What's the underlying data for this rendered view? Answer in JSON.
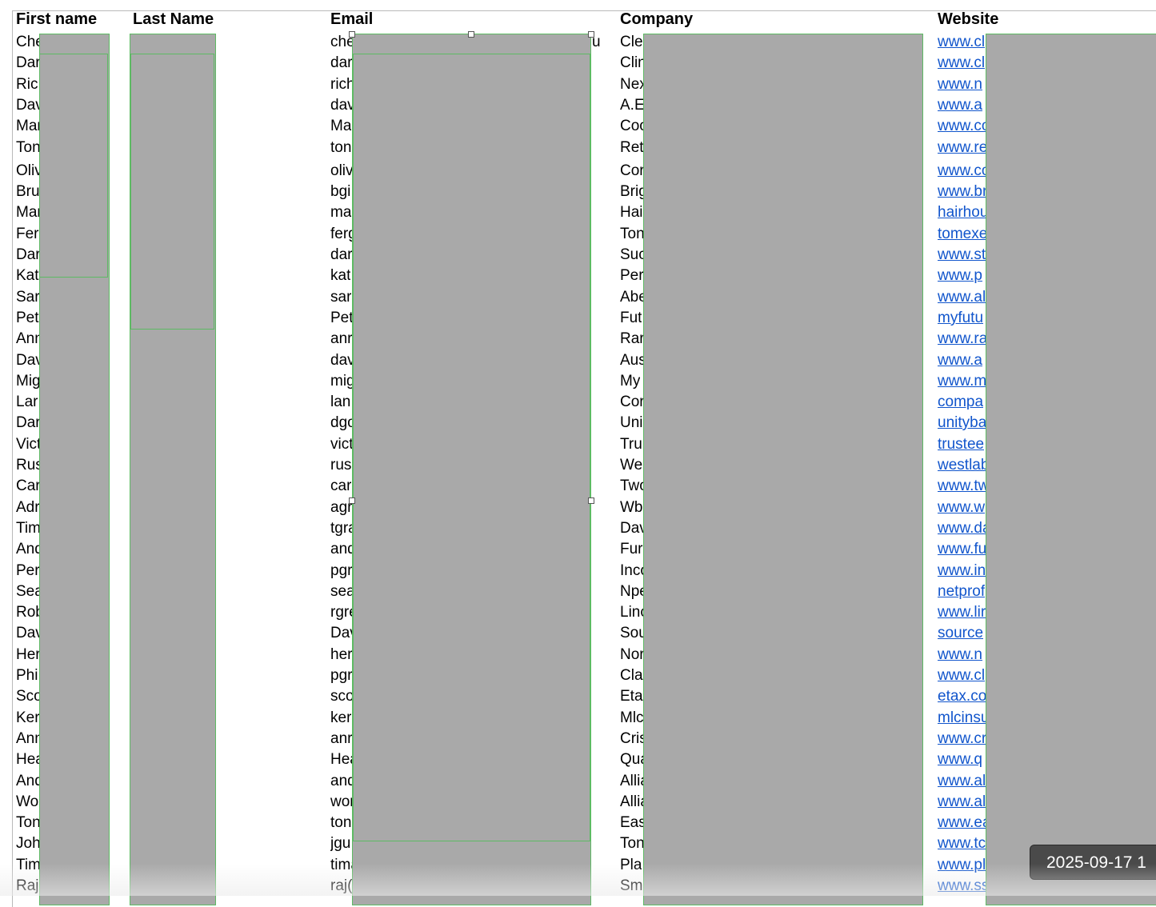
{
  "headers": {
    "first_name": "First name",
    "last_name": "Last Name",
    "email": "Email",
    "company": "Company",
    "website": "Website"
  },
  "rows": [
    {
      "first": "Che",
      "email": "che",
      "company": "Cle",
      "website": "www.cl"
    },
    {
      "first": "Dar",
      "email": "dar",
      "company": "Clin",
      "website": "www.cl"
    },
    {
      "first": "Ric",
      "email": "rich",
      "company": "Nex",
      "website": "www.n"
    },
    {
      "first": "Dav",
      "email": "dav",
      "company": "A.E",
      "website": "www.a"
    },
    {
      "first": "Mar",
      "email": "Ma",
      "company": "Coo",
      "website": "www.co"
    },
    {
      "first": "Ton",
      "email": "ton",
      "company": "Ret",
      "website": "www.re"
    },
    {
      "first": "Oliv",
      "email": "oliv",
      "company": "Cor",
      "website": "www.co"
    },
    {
      "first": "Bru",
      "email": "bgi",
      "company": "Brig",
      "website": "www.br"
    },
    {
      "first": "Mar",
      "email": "ma",
      "company": "Hai",
      "website": "hairhou"
    },
    {
      "first": "Fer",
      "email": "ferg",
      "company": "Ton",
      "website": "tomexe"
    },
    {
      "first": "Dar",
      "email": "dar",
      "company": "Suc",
      "website": "www.st"
    },
    {
      "first": "Kat",
      "email": "kat",
      "company": "Per",
      "website": "www.p"
    },
    {
      "first": "Sar",
      "email": "sar",
      "company": "Abe",
      "website": "www.al"
    },
    {
      "first": "Pet",
      "email": "Pet",
      "company": "Fut",
      "website": "myfutu"
    },
    {
      "first": "Ann",
      "email": "anr",
      "company": "Rar",
      "website": "www.ra"
    },
    {
      "first": "Dav",
      "email": "dav",
      "company": "Aus",
      "website": "www.a"
    },
    {
      "first": "Mig",
      "email": "mig",
      "company": "My",
      "website": "www.m"
    },
    {
      "first": "Lar",
      "email": "lan",
      "company": "Cor",
      "website": "compa"
    },
    {
      "first": "Dar",
      "email": "dgo",
      "company": "Uni",
      "website": "unityba"
    },
    {
      "first": "Vict",
      "email": "vict",
      "company": "Tru",
      "website": "trustee"
    },
    {
      "first": "Rus",
      "email": "rus",
      "company": "We",
      "website": "westlab"
    },
    {
      "first": "Car",
      "email": "car",
      "company": "Two",
      "website": "www.tw"
    },
    {
      "first": "Adr",
      "email": "agr",
      "company": "Wb",
      "website": "www.w"
    },
    {
      "first": "Tim",
      "email": "tgra",
      "company": "Dav",
      "website": "www.da"
    },
    {
      "first": "And",
      "email": "and",
      "company": "Fur",
      "website": "www.fu"
    },
    {
      "first": "Per",
      "email": "pgr",
      "company": "Inco",
      "website": "www.in"
    },
    {
      "first": "Sea",
      "email": "sea",
      "company": "Npe",
      "website": "netprof"
    },
    {
      "first": "Rob",
      "email": "rgre",
      "company": "Linc",
      "website": "www.lir"
    },
    {
      "first": "Dav",
      "email": "Dav",
      "company": "Sou",
      "website": "source"
    },
    {
      "first": "Her",
      "email": "her",
      "company": "Nor",
      "website": "www.n"
    },
    {
      "first": "Phi",
      "email": "pgr",
      "company": "Cla",
      "website": "www.cl"
    },
    {
      "first": "Sco",
      "email": "sco",
      "company": "Eta",
      "website": "etax.co"
    },
    {
      "first": "Ker",
      "email": "ker",
      "company": "Mlc",
      "website": "mlcinsu"
    },
    {
      "first": "Ann",
      "email": "anr",
      "company": "Cris",
      "website": "www.cr"
    },
    {
      "first": "Hea",
      "email": "Hea",
      "company": "Qua",
      "website": "www.q"
    },
    {
      "first": "And",
      "email": "and",
      "company": "Allia",
      "website": "www.al"
    },
    {
      "first": "Wo",
      "email": "wor",
      "company": "Allia",
      "website": "www.al"
    },
    {
      "first": "Ton",
      "email": "ton",
      "company": "Eas",
      "website": "www.ea"
    },
    {
      "first": "Joh",
      "email": "jgu",
      "company": "Ton",
      "website": "www.tc"
    },
    {
      "first": "Tim",
      "email": "tima",
      "company": "Pla",
      "website": "www.pl"
    },
    {
      "first": "Raj",
      "email": "raj(",
      "company": "Sm",
      "website": "www.ss"
    }
  ],
  "email_overflow_char": "u",
  "timestamp": "2025-09-17 1"
}
